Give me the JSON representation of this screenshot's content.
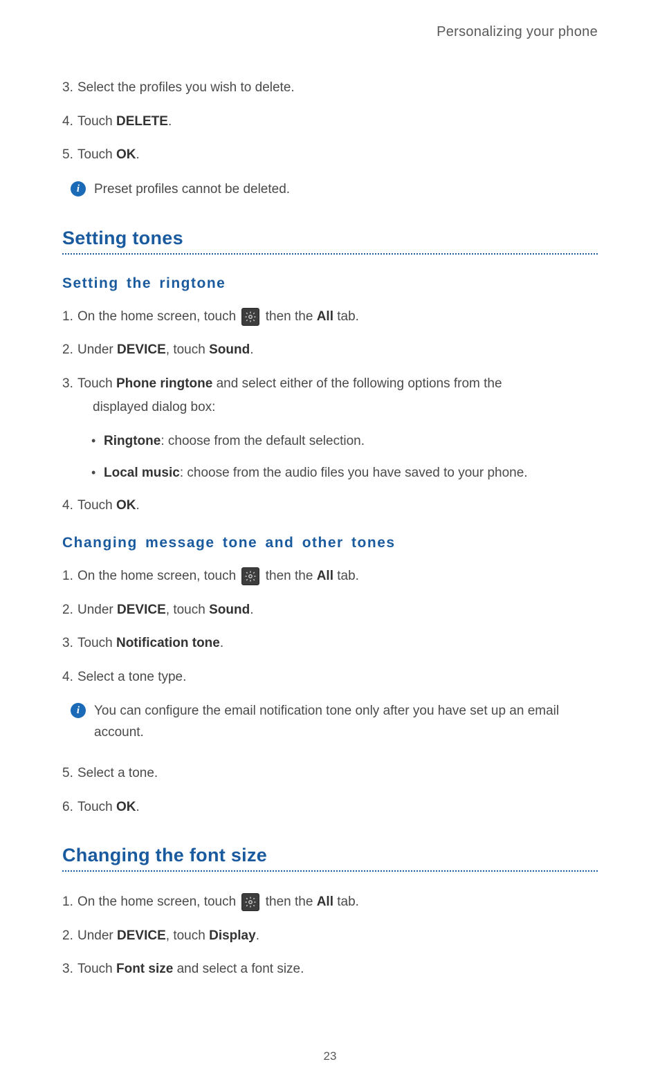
{
  "header": {
    "title": "Personalizing your phone"
  },
  "deleting": {
    "step3": {
      "n": "3.",
      "text": "Select the profiles you wish to delete."
    },
    "step4": {
      "n": "4.",
      "pre": "Touch ",
      "b": "DELETE",
      "post": "."
    },
    "step5": {
      "n": "5.",
      "pre": "Touch ",
      "b": "OK",
      "post": "."
    },
    "note": "Preset profiles cannot be deleted."
  },
  "settingTones": {
    "heading": "Setting tones",
    "ringtone": {
      "subheading": "Setting  the  ringtone",
      "step1": {
        "n": "1.",
        "pre": "On the home screen, touch ",
        "mid": " then the ",
        "b": "All",
        "post": " tab."
      },
      "step2": {
        "n": "2.",
        "pre": "Under ",
        "b1": "DEVICE",
        "mid": ", touch ",
        "b2": "Sound",
        "post": "."
      },
      "step3": {
        "n": "3.",
        "pre": "Touch ",
        "b": "Phone ringtone",
        "post": " and select either of the following options from the ",
        "post2": "displayed dialog box:"
      },
      "bullets": {
        "b1": {
          "bold": "Ringtone",
          "text": ": choose from the default selection."
        },
        "b2": {
          "bold": "Local music",
          "text": ": choose from the audio files you have saved to your phone."
        }
      },
      "step4": {
        "n": "4.",
        "pre": "Touch ",
        "b": "OK",
        "post": "."
      }
    },
    "message": {
      "subheading": "Changing  message  tone  and  other  tones",
      "step1": {
        "n": "1.",
        "pre": "On the home screen, touch ",
        "mid": " then the ",
        "b": "All",
        "post": " tab."
      },
      "step2": {
        "n": "2.",
        "pre": "Under ",
        "b1": "DEVICE",
        "mid": ", touch ",
        "b2": "Sound",
        "post": "."
      },
      "step3": {
        "n": "3.",
        "pre": "Touch ",
        "b": "Notification tone",
        "post": "."
      },
      "step4": {
        "n": "4.",
        "text": "Select a tone type."
      },
      "note": "You can configure the email notification tone only after you have set up an email account.",
      "step5": {
        "n": "5.",
        "text": "Select a tone."
      },
      "step6": {
        "n": "6.",
        "pre": "Touch ",
        "b": "OK",
        "post": "."
      }
    }
  },
  "fontSize": {
    "heading": "Changing the font size",
    "step1": {
      "n": "1.",
      "pre": "On the home screen, touch ",
      "mid": " then the ",
      "b": "All",
      "post": " tab."
    },
    "step2": {
      "n": "2.",
      "pre": "Under ",
      "b1": "DEVICE",
      "mid": ", touch ",
      "b2": "Display",
      "post": "."
    },
    "step3": {
      "n": "3.",
      "pre": "Touch ",
      "b": "Font size",
      "post": " and select a font size."
    }
  },
  "pageNumber": "23",
  "icons": {
    "info": "i"
  }
}
